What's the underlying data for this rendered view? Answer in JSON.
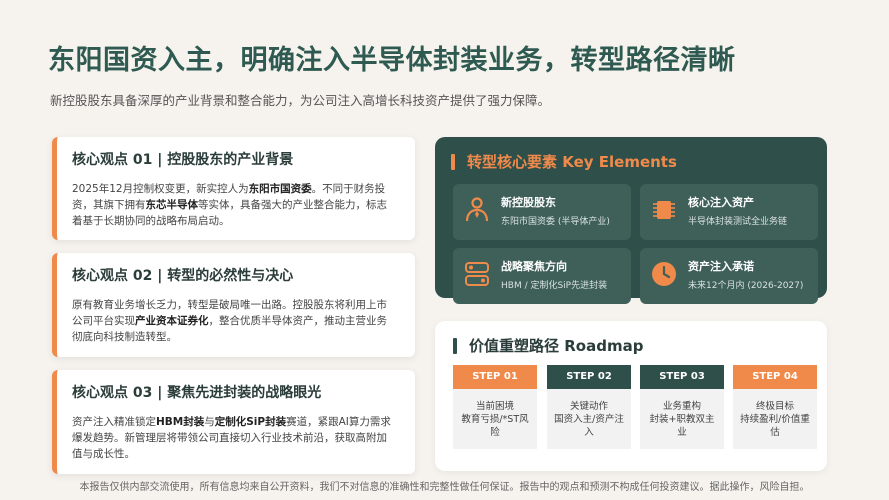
{
  "header": {
    "title": "东阳国资入主，明确注入半导体封装业务，转型路径清晰",
    "subtitle": "新控股股东具备深厚的产业背景和整合能力，为公司注入高增长科技资产提供了强力保障。"
  },
  "cards": [
    {
      "heading": "核心观点 01 | 控股股东的产业背景",
      "body": [
        {
          "t": "2025年12月控制权变更，新实控人为",
          "b": false
        },
        {
          "t": "东阳市国资委",
          "b": true
        },
        {
          "t": "。不同于财务投资，其旗下拥有",
          "b": false
        },
        {
          "t": "东芯半导体",
          "b": true
        },
        {
          "t": "等实体，具备强大的产业整合能力，标志着基于长期协同的战略布局启动。",
          "b": false
        }
      ]
    },
    {
      "heading": "核心观点 02 | 转型的必然性与决心",
      "body": [
        {
          "t": "原有教育业务增长乏力，转型是破局唯一出路。控股股东将利用上市公司平台实现",
          "b": false
        },
        {
          "t": "产业资本证券化",
          "b": true
        },
        {
          "t": "，整合优质半导体资产，推动主营业务彻底向科技制造转型。",
          "b": false
        }
      ]
    },
    {
      "heading": "核心观点 03 | 聚焦先进封装的战略眼光",
      "body": [
        {
          "t": "资产注入精准锁定",
          "b": false
        },
        {
          "t": "HBM封装",
          "b": true
        },
        {
          "t": "与",
          "b": false
        },
        {
          "t": "定制化SiP封装",
          "b": true
        },
        {
          "t": "赛道，紧跟AI算力需求爆发趋势。新管理层将带领公司直接切入行业技术前沿，获取高附加值与成长性。",
          "b": false
        }
      ]
    }
  ],
  "key_elements": {
    "title": "转型核心要素 Key Elements",
    "items": [
      {
        "icon": "person-icon",
        "title": "新控股股东",
        "desc": "东阳市国资委 (半导体产业)"
      },
      {
        "icon": "chip-icon",
        "title": "核心注入资产",
        "desc": "半导体封装测试全业务链"
      },
      {
        "icon": "strategy-icon",
        "title": "战略聚焦方向",
        "desc": "HBM / 定制化SiP先进封装"
      },
      {
        "icon": "clock-icon",
        "title": "资产注入承诺",
        "desc": "未来12个月内 (2026-2027)"
      }
    ]
  },
  "roadmap": {
    "title": "价值重塑路径 Roadmap",
    "steps": [
      {
        "label": "STEP 01",
        "text": "当前困境\n教育亏损/*ST风险",
        "color": "#f08a4b"
      },
      {
        "label": "STEP 02",
        "text": "关键动作\n国资入主/资产注入",
        "color": "#2f4f4a"
      },
      {
        "label": "STEP 03",
        "text": "业务重构\n封装+职教双主业",
        "color": "#2f4f4a"
      },
      {
        "label": "STEP 04",
        "text": "终极目标\n持续盈利/价值重估",
        "color": "#f08a4b"
      }
    ]
  },
  "footer": "本报告仅供内部交流使用，所有信息均来自公开资料，我们不对信息的准确性和完整性做任何保证。报告中的观点和预测不构成任何投资建议。据此操作，风险自担。",
  "colors": {
    "accent": "#f08a4b",
    "dark_green": "#2f4f4a",
    "title_green": "#2f5a51",
    "background": "#f6f3ee"
  }
}
